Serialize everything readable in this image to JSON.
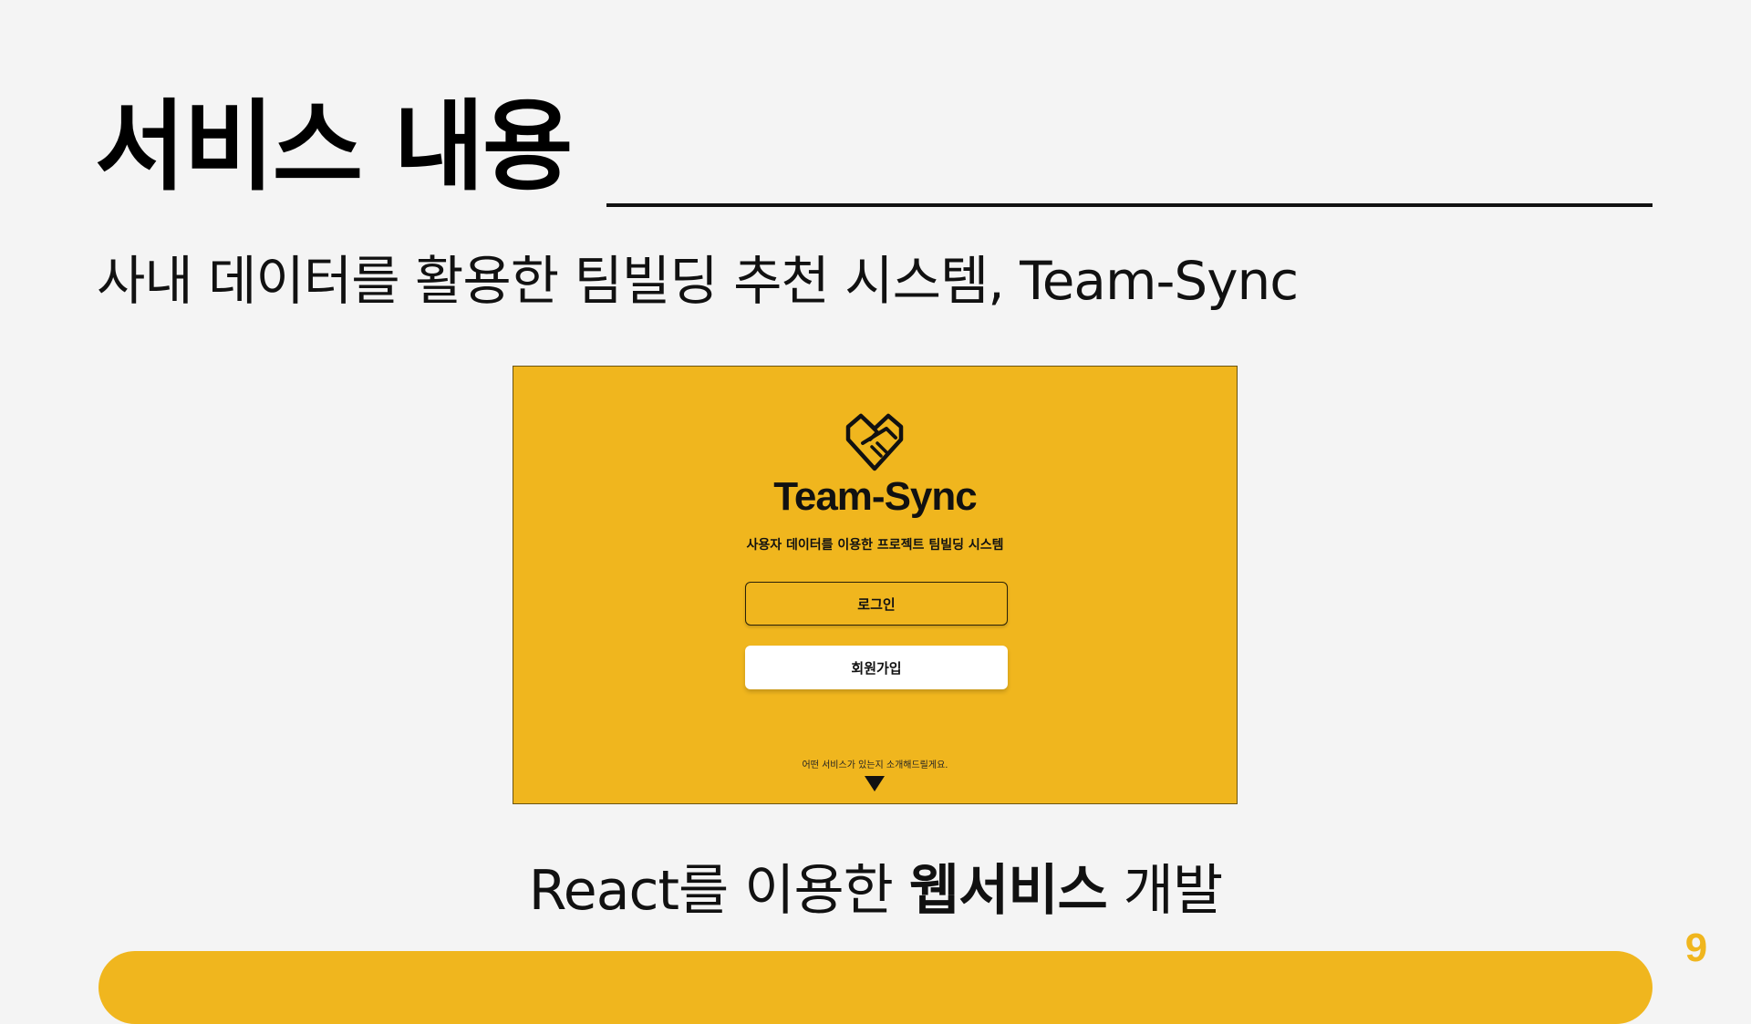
{
  "slide": {
    "title": "서비스 내용",
    "subtitle": "사내 데이터를 활용한 팀빌딩 추천 시스템, Team-Sync",
    "caption_prefix": "React를 이용한 ",
    "caption_bold": "웹서비스",
    "caption_suffix": " 개발",
    "page_number": "9"
  },
  "preview": {
    "logo_icon": "handshake-heart-icon",
    "brand": "Team-Sync",
    "tagline": "사용자 데이터를 이용한 프로젝트 팀빌딩 시스템",
    "login_label": "로그인",
    "signup_label": "회원가입",
    "hint": "어떤 서비스가 있는지 소개해드릴게요.",
    "arrow_icon": "down-triangle-icon"
  },
  "colors": {
    "accent": "#f0b61e",
    "background": "#f4f4f4",
    "text": "#111111",
    "button_white": "#ffffff"
  }
}
